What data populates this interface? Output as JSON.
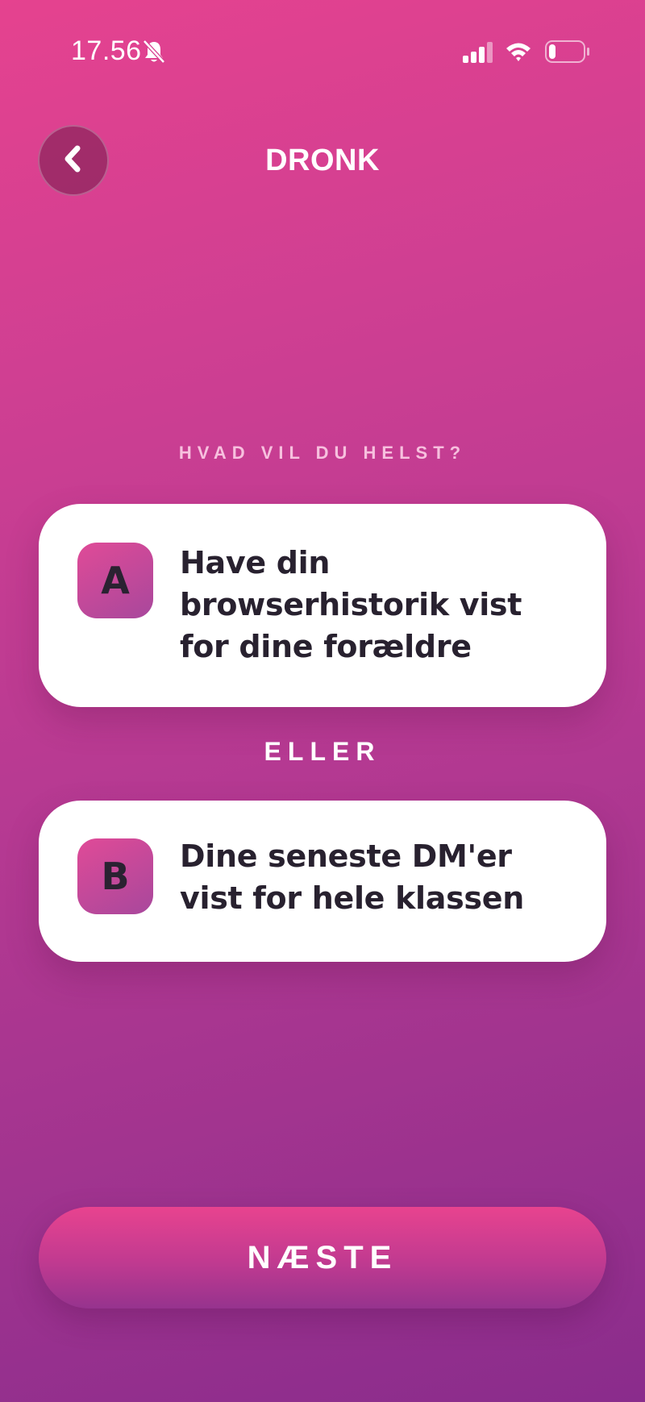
{
  "status_bar": {
    "time": "17.56",
    "icons": [
      "bell-slash-icon",
      "signal-icon",
      "wifi-icon",
      "battery-icon"
    ],
    "battery_level": 0.2
  },
  "header": {
    "back_icon": "chevron-left-icon",
    "title": "DRONK"
  },
  "question": {
    "label": "HVAD VIL DU HELST?",
    "or_label": "ELLER",
    "options": [
      {
        "badge": "A",
        "text": "Have din browserhistorik vist for dine forældre"
      },
      {
        "badge": "B",
        "text": "Dine seneste DM'er vist for hele klassen"
      }
    ]
  },
  "footer": {
    "next_label": "NÆSTE"
  },
  "colors": {
    "background_top": "#e5428f",
    "background_bottom": "#8a2c8c",
    "card": "#ffffff",
    "card_text": "#28212f"
  }
}
